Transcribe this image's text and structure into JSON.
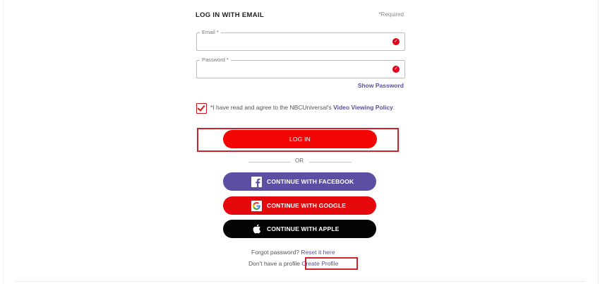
{
  "form": {
    "heading": "LOG IN WITH EMAIL",
    "required_note": "*Required",
    "email": {
      "label": "Email *",
      "value": "",
      "placeholder": ""
    },
    "password": {
      "label": "Password *",
      "value": "",
      "placeholder": ""
    },
    "show_password": "Show Password",
    "agree": {
      "checked": true,
      "text": "*I have read and agree to the NBCUniversal's ",
      "link": "Video Viewing Policy",
      "suffix": "."
    },
    "login_button": "LOG IN",
    "or_text": "OR"
  },
  "social": {
    "facebook": "CONTINUE WITH FACEBOOK",
    "google": "CONTINUE WITH GOOGLE",
    "apple": "CONTINUE WITH APPLE"
  },
  "footer": {
    "forgot_text": "Forgot password? ",
    "forgot_link": "Reset it here",
    "profile_text": "Don't have a profile ",
    "profile_link": "Create Profile"
  },
  "colors": {
    "primary_red": "#f20606",
    "facebook_purple": "#5b4ea3",
    "google_red": "#e5090e",
    "apple_black": "#050505",
    "link_purple": "#5a4e9e",
    "highlight_red": "#c7252f"
  },
  "icons": [
    "error-icon",
    "checkmark-icon",
    "facebook-icon",
    "google-icon",
    "apple-icon"
  ]
}
